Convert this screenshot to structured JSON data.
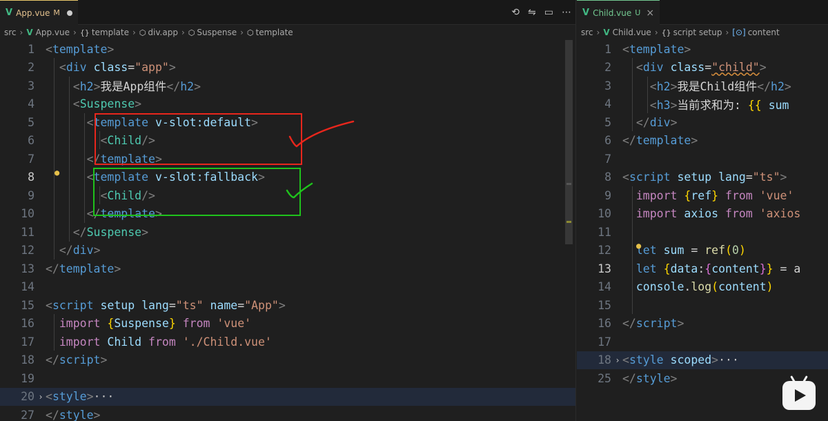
{
  "left": {
    "tab": {
      "name": "App.vue",
      "status": "M"
    },
    "breadcrumb": [
      "src",
      "App.vue",
      "template",
      "div.app",
      "Suspense",
      "template"
    ],
    "lines": [
      {
        "n": "1",
        "tokens": [
          [
            "tag",
            "<"
          ],
          [
            "name",
            "template"
          ],
          [
            "tag",
            ">"
          ]
        ]
      },
      {
        "n": "2",
        "tokens": [
          [
            "t",
            "  "
          ],
          [
            "tag",
            "<"
          ],
          [
            "name",
            "div"
          ],
          [
            "t",
            " "
          ],
          [
            "attr",
            "class"
          ],
          [
            "t",
            "="
          ],
          [
            "str",
            "\"app\""
          ],
          [
            "tag",
            ">"
          ]
        ]
      },
      {
        "n": "3",
        "tokens": [
          [
            "t",
            "    "
          ],
          [
            "tag",
            "<"
          ],
          [
            "name",
            "h2"
          ],
          [
            "tag",
            ">"
          ],
          [
            "t",
            "我是App组件"
          ],
          [
            "tag",
            "</"
          ],
          [
            "name",
            "h2"
          ],
          [
            "tag",
            ">"
          ]
        ]
      },
      {
        "n": "4",
        "tokens": [
          [
            "t",
            "    "
          ],
          [
            "tag",
            "<"
          ],
          [
            "comp",
            "Suspense"
          ],
          [
            "tag",
            ">"
          ]
        ]
      },
      {
        "n": "5",
        "tokens": [
          [
            "t",
            "      "
          ],
          [
            "tag",
            "<"
          ],
          [
            "name",
            "template"
          ],
          [
            "t",
            " "
          ],
          [
            "attr",
            "v-slot:default"
          ],
          [
            "tag",
            ">"
          ]
        ]
      },
      {
        "n": "6",
        "tokens": [
          [
            "t",
            "        "
          ],
          [
            "tag",
            "<"
          ],
          [
            "comp",
            "Child"
          ],
          [
            "tag",
            "/>"
          ]
        ]
      },
      {
        "n": "7",
        "tokens": [
          [
            "t",
            "      "
          ],
          [
            "tag",
            "</"
          ],
          [
            "name",
            "template"
          ],
          [
            "tag",
            ">"
          ]
        ]
      },
      {
        "n": "8",
        "tokens": [
          [
            "t",
            "      "
          ],
          [
            "tag",
            "<"
          ],
          [
            "name",
            "template"
          ],
          [
            "t",
            " "
          ],
          [
            "attr",
            "v-slot:fallback"
          ],
          [
            "tag",
            ">"
          ]
        ]
      },
      {
        "n": "9",
        "tokens": [
          [
            "t",
            "        "
          ],
          [
            "tag",
            "<"
          ],
          [
            "comp",
            "Child"
          ],
          [
            "tag",
            "/>"
          ]
        ]
      },
      {
        "n": "10",
        "tokens": [
          [
            "t",
            "      "
          ],
          [
            "tag",
            "</"
          ],
          [
            "name",
            "template"
          ],
          [
            "tag",
            ">"
          ]
        ]
      },
      {
        "n": "11",
        "tokens": [
          [
            "t",
            "    "
          ],
          [
            "tag",
            "</"
          ],
          [
            "comp",
            "Suspense"
          ],
          [
            "tag",
            ">"
          ]
        ]
      },
      {
        "n": "12",
        "tokens": [
          [
            "t",
            "  "
          ],
          [
            "tag",
            "</"
          ],
          [
            "name",
            "div"
          ],
          [
            "tag",
            ">"
          ]
        ]
      },
      {
        "n": "13",
        "tokens": [
          [
            "tag",
            "</"
          ],
          [
            "name",
            "template"
          ],
          [
            "tag",
            ">"
          ]
        ]
      },
      {
        "n": "14",
        "tokens": []
      },
      {
        "n": "15",
        "tokens": [
          [
            "tag",
            "<"
          ],
          [
            "name",
            "script"
          ],
          [
            "t",
            " "
          ],
          [
            "attr",
            "setup"
          ],
          [
            "t",
            " "
          ],
          [
            "attr",
            "lang"
          ],
          [
            "t",
            "="
          ],
          [
            "str",
            "\"ts\""
          ],
          [
            "t",
            " "
          ],
          [
            "attr",
            "name"
          ],
          [
            "t",
            "="
          ],
          [
            "str",
            "\"App\""
          ],
          [
            "tag",
            ">"
          ]
        ]
      },
      {
        "n": "16",
        "tokens": [
          [
            "t",
            "  "
          ],
          [
            "kw",
            "import"
          ],
          [
            "t",
            " "
          ],
          [
            "brace",
            "{"
          ],
          [
            "var",
            "Suspense"
          ],
          [
            "brace",
            "}"
          ],
          [
            "t",
            " "
          ],
          [
            "kw",
            "from"
          ],
          [
            "t",
            " "
          ],
          [
            "str",
            "'vue'"
          ]
        ]
      },
      {
        "n": "17",
        "tokens": [
          [
            "t",
            "  "
          ],
          [
            "kw",
            "import"
          ],
          [
            "t",
            " "
          ],
          [
            "var",
            "Child"
          ],
          [
            "t",
            " "
          ],
          [
            "kw",
            "from"
          ],
          [
            "t",
            " "
          ],
          [
            "str",
            "'./Child.vue'"
          ]
        ]
      },
      {
        "n": "18",
        "tokens": [
          [
            "tag",
            "</"
          ],
          [
            "name",
            "script"
          ],
          [
            "tag",
            ">"
          ]
        ]
      },
      {
        "n": "19",
        "tokens": []
      },
      {
        "n": "20",
        "tokens": [
          [
            "tag",
            "<"
          ],
          [
            "name",
            "style"
          ],
          [
            "tag",
            ">"
          ],
          [
            "ell",
            "···"
          ]
        ]
      },
      {
        "n": "27",
        "tokens": [
          [
            "tag",
            "</"
          ],
          [
            "name",
            "style"
          ],
          [
            "tag",
            ">"
          ]
        ]
      }
    ]
  },
  "right": {
    "tab": {
      "name": "Child.vue",
      "status": "U"
    },
    "breadcrumb": [
      "src",
      "Child.vue",
      "script setup",
      "content"
    ],
    "lines": [
      {
        "n": "1",
        "tokens": [
          [
            "tag",
            "<"
          ],
          [
            "name",
            "template"
          ],
          [
            "tag",
            ">"
          ]
        ]
      },
      {
        "n": "2",
        "tokens": [
          [
            "t",
            "  "
          ],
          [
            "tag",
            "<"
          ],
          [
            "name",
            "div"
          ],
          [
            "t",
            " "
          ],
          [
            "attr",
            "class"
          ],
          [
            "t",
            "="
          ],
          [
            "strq",
            "\"child\""
          ],
          [
            "tag",
            ">"
          ]
        ]
      },
      {
        "n": "3",
        "tokens": [
          [
            "t",
            "    "
          ],
          [
            "tag",
            "<"
          ],
          [
            "name",
            "h2"
          ],
          [
            "tag",
            ">"
          ],
          [
            "t",
            "我是Child组件"
          ],
          [
            "tag",
            "</"
          ],
          [
            "name",
            "h2"
          ],
          [
            "tag",
            ">"
          ]
        ]
      },
      {
        "n": "4",
        "tokens": [
          [
            "t",
            "    "
          ],
          [
            "tag",
            "<"
          ],
          [
            "name",
            "h3"
          ],
          [
            "tag",
            ">"
          ],
          [
            "t",
            "当前求和为: "
          ],
          [
            "brace",
            "{{"
          ],
          [
            "t",
            " "
          ],
          [
            "var",
            "sum"
          ]
        ]
      },
      {
        "n": "5",
        "tokens": [
          [
            "t",
            "  "
          ],
          [
            "tag",
            "</"
          ],
          [
            "name",
            "div"
          ],
          [
            "tag",
            ">"
          ]
        ]
      },
      {
        "n": "6",
        "tokens": [
          [
            "tag",
            "</"
          ],
          [
            "name",
            "template"
          ],
          [
            "tag",
            ">"
          ]
        ]
      },
      {
        "n": "7",
        "tokens": []
      },
      {
        "n": "8",
        "tokens": [
          [
            "tag",
            "<"
          ],
          [
            "name",
            "script"
          ],
          [
            "t",
            " "
          ],
          [
            "attr",
            "setup"
          ],
          [
            "t",
            " "
          ],
          [
            "attr",
            "lang"
          ],
          [
            "t",
            "="
          ],
          [
            "str",
            "\"ts\""
          ],
          [
            "tag",
            ">"
          ]
        ]
      },
      {
        "n": "9",
        "tokens": [
          [
            "t",
            "  "
          ],
          [
            "kw",
            "import"
          ],
          [
            "t",
            " "
          ],
          [
            "brace",
            "{"
          ],
          [
            "var",
            "ref"
          ],
          [
            "brace",
            "}"
          ],
          [
            "t",
            " "
          ],
          [
            "kw",
            "from"
          ],
          [
            "t",
            " "
          ],
          [
            "str",
            "'vue'"
          ]
        ]
      },
      {
        "n": "10",
        "tokens": [
          [
            "t",
            "  "
          ],
          [
            "kw",
            "import"
          ],
          [
            "t",
            " "
          ],
          [
            "var",
            "axios"
          ],
          [
            "t",
            " "
          ],
          [
            "kw",
            "from"
          ],
          [
            "t",
            " "
          ],
          [
            "str",
            "'axios"
          ]
        ]
      },
      {
        "n": "11",
        "tokens": []
      },
      {
        "n": "12",
        "tokens": [
          [
            "t",
            "  "
          ],
          [
            "decl",
            "let"
          ],
          [
            "t",
            " "
          ],
          [
            "var",
            "sum"
          ],
          [
            "t",
            " = "
          ],
          [
            "fn",
            "ref"
          ],
          [
            "brace",
            "("
          ],
          [
            "num",
            "0"
          ],
          [
            "brace",
            ")"
          ]
        ]
      },
      {
        "n": "13",
        "tokens": [
          [
            "t",
            "  "
          ],
          [
            "decl",
            "let"
          ],
          [
            "t",
            " "
          ],
          [
            "brace",
            "{"
          ],
          [
            "var",
            "data"
          ],
          [
            "t",
            ":"
          ],
          [
            "brace2",
            "{"
          ],
          [
            "var",
            "content"
          ],
          [
            "brace2",
            "}"
          ],
          [
            "brace",
            "}"
          ],
          [
            "t",
            " = a"
          ]
        ]
      },
      {
        "n": "14",
        "tokens": [
          [
            "t",
            "  "
          ],
          [
            "var",
            "console"
          ],
          [
            "t",
            "."
          ],
          [
            "fn",
            "log"
          ],
          [
            "brace",
            "("
          ],
          [
            "var",
            "content"
          ],
          [
            "brace",
            ")"
          ]
        ]
      },
      {
        "n": "15",
        "tokens": []
      },
      {
        "n": "16",
        "tokens": [
          [
            "tag",
            "</"
          ],
          [
            "name",
            "script"
          ],
          [
            "tag",
            ">"
          ]
        ]
      },
      {
        "n": "17",
        "tokens": []
      },
      {
        "n": "18",
        "tokens": [
          [
            "tag",
            "<"
          ],
          [
            "name",
            "style"
          ],
          [
            "t",
            " "
          ],
          [
            "attr",
            "scoped"
          ],
          [
            "tag",
            ">"
          ],
          [
            "ell",
            "···"
          ]
        ]
      },
      {
        "n": "25",
        "tokens": [
          [
            "tag",
            "</"
          ],
          [
            "name",
            "style"
          ],
          [
            "tag",
            ">"
          ]
        ]
      }
    ]
  },
  "colors": {
    "red_annotation": "#e8261c",
    "green_annotation": "#1fc21c",
    "vue_green": "#41b883"
  }
}
